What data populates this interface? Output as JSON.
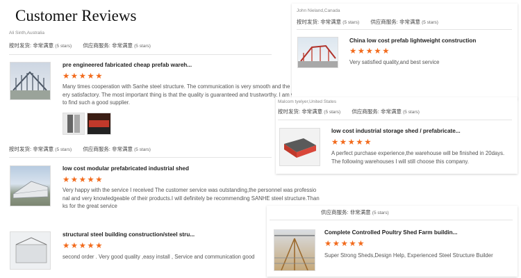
{
  "page_title": "Customer Reviews",
  "left": {
    "reviewer": "Ali Sinth,Australia",
    "rating_top": {
      "delivery_label": "按时发货:",
      "delivery_value": "非常满意",
      "delivery_stars": "(5 stars)",
      "service_label": "供应商服务:",
      "service_value": "非常满意",
      "service_stars": "(5 stars)"
    },
    "reviews": [
      {
        "product": "pre engineered fabricated cheap prefab wareh...",
        "stars": "★★★★★",
        "lines": [
          "Many times cooperation with Sanhe steel structure. The communication is very smooth and the service is v",
          "ery satisfactory. The most important thing is that the quality is guaranteed and trustworthy. I am very happy",
          "to find such a good supplier."
        ]
      },
      {
        "product": "low cost modular prefabricated industrial shed",
        "stars": "★★★★★",
        "lines": [
          "Very happy with the service I received The customer service was outstanding,the personnel was professio",
          "nal and very knowledgeable of their products.I will definitely be recommending SANHE steel structure.Than",
          "ks for the great service"
        ]
      },
      {
        "product": "structural steel building construction/steel stru...",
        "stars": "★★★★★",
        "lines": [
          "second order . Very good quality ,easy install , Service and communication good"
        ]
      }
    ],
    "rating_mid": {
      "delivery_label": "按时发货:",
      "delivery_value": "非常满意",
      "delivery_stars": "(5 stars)",
      "service_label": "供应商服务:",
      "service_value": "非常满意",
      "service_stars": "(5 stars)"
    }
  },
  "right": {
    "reviewer": "John Nieland,Canada",
    "rating_top": {
      "delivery_label": "按时发货:",
      "delivery_value": "非常满意",
      "delivery_stars": "(5 stars)",
      "service_label": "供应商服务:",
      "service_value": "非常满意",
      "service_stars": "(5 stars)"
    },
    "review1": {
      "product": "China low cost prefab lightweight construction",
      "stars": "★★★★★",
      "lines": [
        "Very satisfied quality,and best service"
      ]
    },
    "reviewer2": "Malcom tyelyer,United States",
    "rating_mid": {
      "delivery_label": "按时发货:",
      "delivery_value": "非常满意",
      "delivery_stars": "(5 stars)",
      "service_label": "供应商服务:",
      "service_value": "非常满意",
      "service_stars": "(5 stars)"
    },
    "review2": {
      "product": "low cost industrial storage shed / prefabricate...",
      "stars": "★★★★★",
      "lines": [
        "A perfect purchase experience,the warehouse will be finished in 20days.",
        "The following warehouses I will still choose this company."
      ]
    },
    "rating_bottom": {
      "service_label": "供应商服务:",
      "service_value": "非常满意",
      "service_stars": "(5 stars)"
    },
    "review3": {
      "product": "Complete Controlled Poultry Shed Farm buildin...",
      "stars": "★★★★★",
      "lines": [
        "Super Strong Sheds,Design Help, Experienced Steel Structure Builder"
      ]
    }
  }
}
